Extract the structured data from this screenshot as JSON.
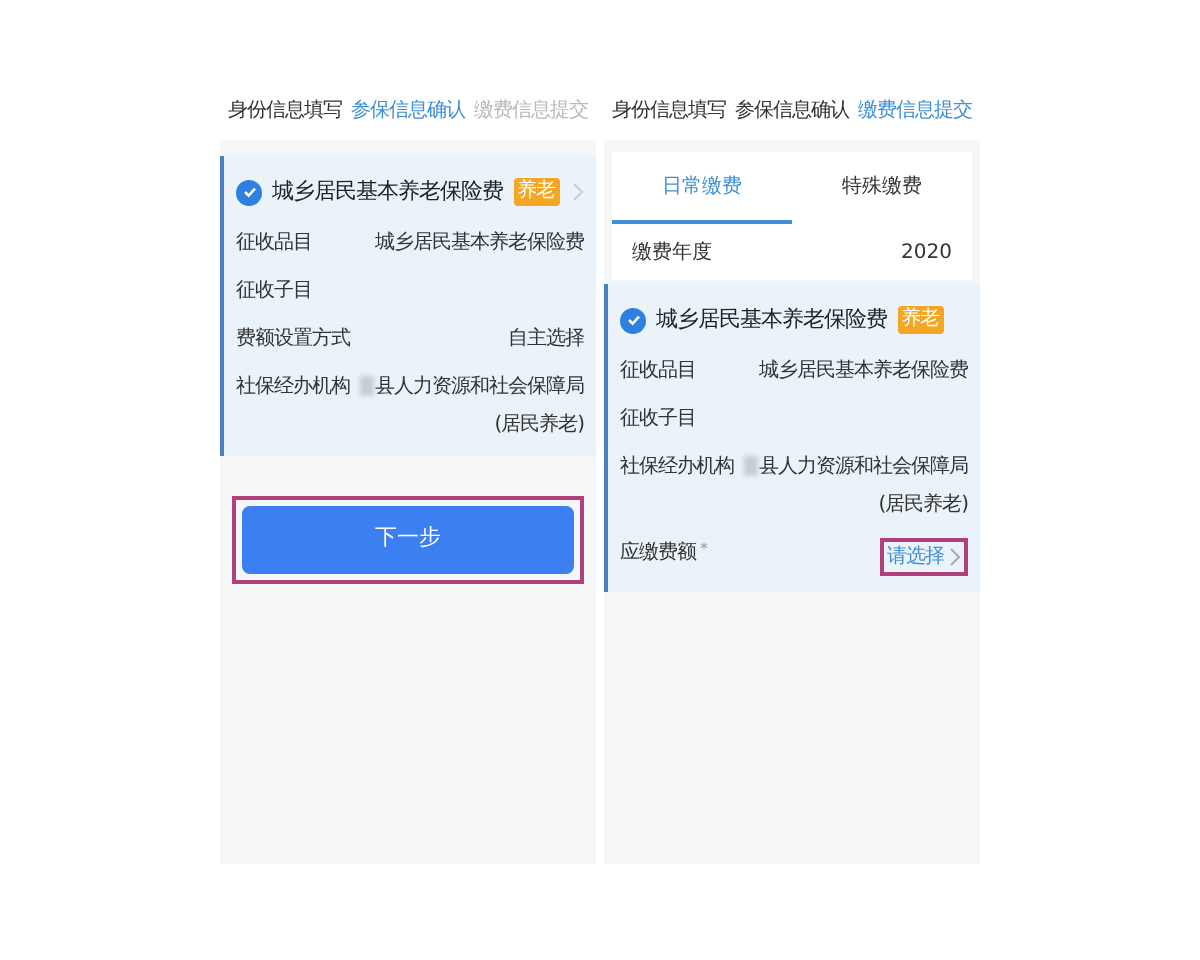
{
  "panels": [
    {
      "steps": [
        {
          "label": "身份信息填写",
          "selected": false,
          "disabled": false
        },
        {
          "label": "参保信息确认",
          "selected": true,
          "disabled": false
        },
        {
          "label": "缴费信息提交",
          "selected": false,
          "disabled": true
        }
      ],
      "card": {
        "checked": true,
        "title": "城乡居民基本养老保险费",
        "tag": "养老",
        "chevron": true,
        "fields": [
          {
            "kind": "text",
            "label": "征收品目",
            "lines": [
              "城乡居民基本养老保险费"
            ]
          },
          {
            "kind": "text",
            "label": "征收子目"
          },
          {
            "kind": "text",
            "label": "费额设置方式",
            "lines": [
              "自主选择"
            ]
          },
          {
            "kind": "text",
            "label": "社保经办机构",
            "redacted": true,
            "lines": [
              "县人力资源和社会保障局",
              "(居民养老)"
            ]
          }
        ]
      },
      "button": {
        "label": "下一步",
        "highlighted": true
      }
    },
    {
      "steps": [
        {
          "label": "身份信息填写",
          "selected": false,
          "disabled": false
        },
        {
          "label": "参保信息确认",
          "selected": false,
          "disabled": false
        },
        {
          "label": "缴费信息提交",
          "selected": true,
          "disabled": false
        }
      ],
      "pay_tabs": [
        {
          "label": "日常缴费",
          "selected": true
        },
        {
          "label": "特殊缴费",
          "selected": false
        }
      ],
      "year": {
        "label": "缴费年度",
        "value": "2020"
      },
      "card": {
        "checked": true,
        "title": "城乡居民基本养老保险费",
        "tag": "养老",
        "chevron": false,
        "fields": [
          {
            "kind": "text",
            "label": "征收品目",
            "lines": [
              "城乡居民基本养老保险费"
            ]
          },
          {
            "kind": "text",
            "label": "征收子目"
          },
          {
            "kind": "text",
            "label": "社保经办机构",
            "redacted": true,
            "lines": [
              "县人力资源和社会保障局",
              "(居民养老)"
            ]
          },
          {
            "kind": "picker",
            "label": "应缴费额",
            "required_mark": "*",
            "value": "请选择",
            "highlighted": true
          }
        ]
      }
    }
  ]
}
